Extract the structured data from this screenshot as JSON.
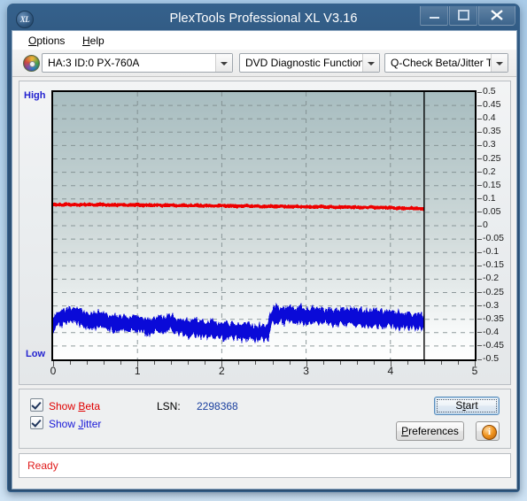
{
  "window": {
    "title": "PlexTools Professional XL V3.16",
    "app_icon_text": "XL",
    "minimize_label": "Minimize",
    "maximize_label": "Maximize",
    "close_label": "Close"
  },
  "menu": {
    "items": [
      {
        "label": "Options",
        "accel": "O"
      },
      {
        "label": "Help",
        "accel": "H"
      }
    ]
  },
  "toolbar": {
    "drive_icon": "optical-disc-icon",
    "drive_combo": "HA:3 ID:0  PX-760A",
    "function_combo": "DVD Diagnostic Functions",
    "test_combo": "Q-Check Beta/Jitter Test"
  },
  "chart_data": {
    "type": "line",
    "title": "",
    "xlabel": "",
    "ylabel": "",
    "xlim": [
      0,
      5
    ],
    "ylim": [
      -0.5,
      0.5
    ],
    "xticks": [
      0,
      1,
      2,
      3,
      4,
      5
    ],
    "yticks": [
      0.5,
      0.45,
      0.4,
      0.35,
      0.3,
      0.25,
      0.2,
      0.15,
      0.1,
      0.05,
      0,
      -0.05,
      -0.1,
      -0.15,
      -0.2,
      -0.25,
      -0.3,
      -0.35,
      -0.4,
      -0.45,
      -0.5
    ],
    "ytick_labels": [
      "0.5",
      "0.45",
      "0.4",
      "0.35",
      "0.3",
      "0.25",
      "0.2",
      "0.15",
      "0.1",
      "0.05",
      "0",
      "-0.05",
      "-0.1",
      "-0.15",
      "-0.2",
      "-0.25",
      "-0.3",
      "-0.35",
      "-0.4",
      "-0.45",
      "-0.5"
    ],
    "axis_words": {
      "high": "High",
      "low": "Low"
    },
    "grid": true,
    "grid_style": "dashed",
    "legend_position": "below-chart",
    "scan_end_x": 4.4,
    "series": [
      {
        "name": "Beta",
        "color": "#ee0000",
        "x_start": 0,
        "x_end": 4.4,
        "mean_level": 0.075,
        "noise_band": 0.012,
        "description": "Beta value flat near 0.07-0.08 across the disc, slight downward drift toward outer edge.",
        "samples": [
          0.079,
          0.078,
          0.08,
          0.077,
          0.081,
          0.079,
          0.078,
          0.08,
          0.077,
          0.079,
          0.08,
          0.078,
          0.079,
          0.077,
          0.078,
          0.08,
          0.079,
          0.077,
          0.078,
          0.079,
          0.078,
          0.077,
          0.079,
          0.078,
          0.076,
          0.078,
          0.077,
          0.079,
          0.077,
          0.076,
          0.078,
          0.077,
          0.076,
          0.078,
          0.077,
          0.075,
          0.077,
          0.076,
          0.078,
          0.076,
          0.075,
          0.077,
          0.076,
          0.074,
          0.076,
          0.075,
          0.077,
          0.075,
          0.074,
          0.076,
          0.075,
          0.073,
          0.075,
          0.074,
          0.076,
          0.074,
          0.073,
          0.075,
          0.074,
          0.072,
          0.074,
          0.073,
          0.075,
          0.073,
          0.072,
          0.074,
          0.073,
          0.071,
          0.073,
          0.072,
          0.074,
          0.072,
          0.071,
          0.073,
          0.072,
          0.07,
          0.072,
          0.071,
          0.073,
          0.071,
          0.07,
          0.072,
          0.071,
          0.069,
          0.071,
          0.07,
          0.072,
          0.07,
          0.069,
          0.071,
          0.07,
          0.068,
          0.07,
          0.069,
          0.071,
          0.069,
          0.068,
          0.07,
          0.069,
          0.067,
          0.069,
          0.068,
          0.07,
          0.068,
          0.067,
          0.069,
          0.068,
          0.066,
          0.068,
          0.067,
          0.065,
          0.067,
          0.066,
          0.064,
          0.066,
          0.065,
          0.063,
          0.065,
          0.064,
          0.062
        ]
      },
      {
        "name": "Jitter",
        "color": "#0a0ad8",
        "x_start": 0,
        "x_end": 4.4,
        "mean_level": -0.355,
        "noise_band": 0.035,
        "description": "Jitter noise band around -0.30 to -0.42; starts high near -0.33, declines gradually to about -0.40 by x=1.75, steps back up to -0.33 and stays roughly level with slight decline to the end of the scan at 4.4.",
        "samples": [
          -0.37,
          -0.355,
          -0.345,
          -0.34,
          -0.338,
          -0.335,
          -0.333,
          -0.334,
          -0.336,
          -0.34,
          -0.348,
          -0.352,
          -0.355,
          -0.358,
          -0.356,
          -0.354,
          -0.357,
          -0.36,
          -0.362,
          -0.365,
          -0.363,
          -0.361,
          -0.364,
          -0.367,
          -0.37,
          -0.372,
          -0.369,
          -0.366,
          -0.368,
          -0.371,
          -0.374,
          -0.377,
          -0.375,
          -0.372,
          -0.37,
          -0.368,
          -0.365,
          -0.363,
          -0.366,
          -0.37,
          -0.374,
          -0.378,
          -0.381,
          -0.384,
          -0.382,
          -0.379,
          -0.381,
          -0.384,
          -0.387,
          -0.39,
          -0.388,
          -0.385,
          -0.387,
          -0.39,
          -0.393,
          -0.395,
          -0.392,
          -0.39,
          -0.393,
          -0.396,
          -0.398,
          -0.4,
          -0.397,
          -0.395,
          -0.398,
          -0.401,
          -0.403,
          -0.4,
          -0.398,
          -0.396,
          -0.34,
          -0.335,
          -0.332,
          -0.334,
          -0.336,
          -0.333,
          -0.331,
          -0.334,
          -0.337,
          -0.335,
          -0.333,
          -0.336,
          -0.339,
          -0.337,
          -0.335,
          -0.338,
          -0.341,
          -0.339,
          -0.337,
          -0.34,
          -0.343,
          -0.341,
          -0.339,
          -0.342,
          -0.345,
          -0.343,
          -0.341,
          -0.344,
          -0.347,
          -0.345,
          -0.343,
          -0.346,
          -0.349,
          -0.347,
          -0.345,
          -0.348,
          -0.351,
          -0.349,
          -0.347,
          -0.35,
          -0.353,
          -0.351,
          -0.354,
          -0.357,
          -0.355,
          -0.358,
          -0.361,
          -0.359,
          -0.362,
          -0.365
        ]
      }
    ]
  },
  "controls": {
    "show_beta": {
      "label": "Show Beta",
      "accel": "B",
      "checked": true,
      "color": "#e00000"
    },
    "show_jitter": {
      "label": "Show Jitter",
      "accel": "J",
      "checked": true,
      "color": "#1818d8"
    },
    "lsn_label": "LSN:",
    "lsn_value": "2298368",
    "start_button": {
      "label": "Start",
      "accel": "t"
    },
    "preferences_button": {
      "label": "Preferences",
      "accel": "P"
    },
    "info_button": {
      "label": "i",
      "icon": "info-icon"
    }
  },
  "status": {
    "text": "Ready"
  }
}
